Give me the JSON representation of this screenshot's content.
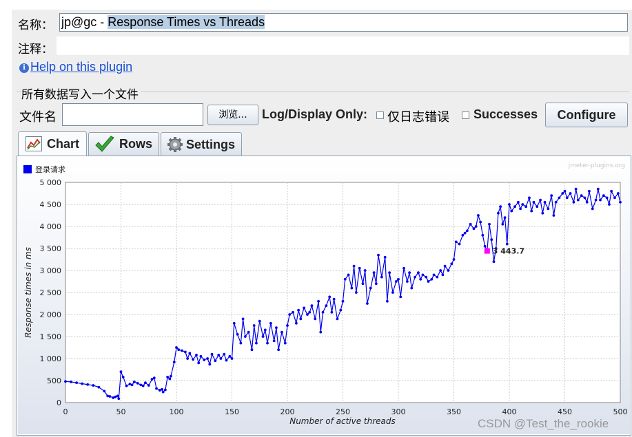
{
  "form": {
    "name_label": "名称：",
    "name_value_prefix": "jp@gc - ",
    "name_value_selected": "Response Times vs Threads",
    "comment_label": "注释：",
    "help_link": "Help on this plugin"
  },
  "file_section": {
    "group_title": "所有数据写入一个文件",
    "filename_label": "文件名",
    "filename_value": "",
    "browse_button": "浏览...",
    "log_only_label": "Log/Display Only:",
    "errors_checkbox_label": "仅日志错误",
    "successes_checkbox_label": "Successes",
    "configure_button": "Configure"
  },
  "tabs": [
    {
      "label": "Chart",
      "icon": "chart-icon",
      "active": true
    },
    {
      "label": "Rows",
      "icon": "checkmark-icon",
      "active": false
    },
    {
      "label": "Settings",
      "icon": "gear-icon",
      "active": false
    }
  ],
  "chart_credit": "jmeter-plugins.org",
  "chart_data": {
    "type": "line",
    "series": [
      {
        "name": "登录请求",
        "color": "#0000ee"
      }
    ],
    "xlabel": "Number of active threads",
    "ylabel": "Response times in ms",
    "xlim": [
      0,
      500
    ],
    "ylim": [
      0,
      5000
    ],
    "x_ticks": [
      "0",
      "50",
      "100",
      "150",
      "200",
      "250",
      "300",
      "350",
      "400",
      "450",
      "500"
    ],
    "y_ticks": [
      "0",
      "500",
      "1 000",
      "1 500",
      "2 000",
      "2 500",
      "3 000",
      "3 500",
      "4 000",
      "4 500",
      "5 000"
    ],
    "grid": true,
    "legend_position": "top-left",
    "highlight": {
      "x": 380,
      "y": 3443.7,
      "label": "3 443.7",
      "color": "#ff00ff"
    },
    "points": [
      [
        0,
        480
      ],
      [
        5,
        470
      ],
      [
        10,
        450
      ],
      [
        15,
        430
      ],
      [
        20,
        410
      ],
      [
        25,
        390
      ],
      [
        30,
        350
      ],
      [
        35,
        260
      ],
      [
        38,
        150
      ],
      [
        40,
        140
      ],
      [
        43,
        110
      ],
      [
        45,
        130
      ],
      [
        47,
        150
      ],
      [
        48,
        90
      ],
      [
        50,
        700
      ],
      [
        52,
        580
      ],
      [
        55,
        380
      ],
      [
        58,
        420
      ],
      [
        60,
        400
      ],
      [
        62,
        470
      ],
      [
        65,
        440
      ],
      [
        68,
        400
      ],
      [
        70,
        380
      ],
      [
        72,
        450
      ],
      [
        75,
        390
      ],
      [
        78,
        530
      ],
      [
        80,
        560
      ],
      [
        82,
        320
      ],
      [
        85,
        280
      ],
      [
        87,
        300
      ],
      [
        88,
        240
      ],
      [
        90,
        290
      ],
      [
        92,
        580
      ],
      [
        94,
        540
      ],
      [
        95,
        600
      ],
      [
        98,
        920
      ],
      [
        100,
        1250
      ],
      [
        102,
        1200
      ],
      [
        105,
        1180
      ],
      [
        108,
        1150
      ],
      [
        110,
        1000
      ],
      [
        112,
        1120
      ],
      [
        115,
        980
      ],
      [
        118,
        1080
      ],
      [
        120,
        900
      ],
      [
        122,
        1050
      ],
      [
        125,
        970
      ],
      [
        128,
        1000
      ],
      [
        130,
        870
      ],
      [
        132,
        1100
      ],
      [
        135,
        950
      ],
      [
        138,
        1080
      ],
      [
        140,
        1000
      ],
      [
        143,
        1100
      ],
      [
        145,
        960
      ],
      [
        148,
        1050
      ],
      [
        150,
        1000
      ],
      [
        152,
        1800
      ],
      [
        155,
        1550
      ],
      [
        158,
        1350
      ],
      [
        160,
        1900
      ],
      [
        162,
        1500
      ],
      [
        165,
        1600
      ],
      [
        168,
        1200
      ],
      [
        170,
        1750
      ],
      [
        172,
        1350
      ],
      [
        175,
        1850
      ],
      [
        178,
        1500
      ],
      [
        180,
        1650
      ],
      [
        182,
        1350
      ],
      [
        185,
        1800
      ],
      [
        188,
        1400
      ],
      [
        190,
        1700
      ],
      [
        192,
        1200
      ],
      [
        195,
        1600
      ],
      [
        198,
        1350
      ],
      [
        200,
        1750
      ],
      [
        202,
        2000
      ],
      [
        205,
        2050
      ],
      [
        208,
        1800
      ],
      [
        210,
        2100
      ],
      [
        212,
        1900
      ],
      [
        215,
        2150
      ],
      [
        218,
        2000
      ],
      [
        220,
        2050
      ],
      [
        222,
        2200
      ],
      [
        225,
        1900
      ],
      [
        228,
        2300
      ],
      [
        230,
        1600
      ],
      [
        232,
        2050
      ],
      [
        235,
        2200
      ],
      [
        238,
        2400
      ],
      [
        240,
        2050
      ],
      [
        242,
        2350
      ],
      [
        245,
        1900
      ],
      [
        248,
        2100
      ],
      [
        250,
        2300
      ],
      [
        252,
        2800
      ],
      [
        255,
        2900
      ],
      [
        258,
        2600
      ],
      [
        260,
        3100
      ],
      [
        262,
        2500
      ],
      [
        265,
        3050
      ],
      [
        268,
        2700
      ],
      [
        270,
        3000
      ],
      [
        272,
        2250
      ],
      [
        275,
        2600
      ],
      [
        278,
        2950
      ],
      [
        280,
        2700
      ],
      [
        282,
        3350
      ],
      [
        285,
        2850
      ],
      [
        288,
        3300
      ],
      [
        290,
        2300
      ],
      [
        292,
        2950
      ],
      [
        295,
        2500
      ],
      [
        298,
        2750
      ],
      [
        300,
        2800
      ],
      [
        302,
        2400
      ],
      [
        305,
        3050
      ],
      [
        308,
        2750
      ],
      [
        310,
        2950
      ],
      [
        312,
        2600
      ],
      [
        315,
        2850
      ],
      [
        318,
        2950
      ],
      [
        320,
        2800
      ],
      [
        322,
        2900
      ],
      [
        325,
        2850
      ],
      [
        327,
        2750
      ],
      [
        330,
        2800
      ],
      [
        332,
        2900
      ],
      [
        335,
        2850
      ],
      [
        338,
        3000
      ],
      [
        340,
        2900
      ],
      [
        342,
        3100
      ],
      [
        345,
        3000
      ],
      [
        348,
        3150
      ],
      [
        350,
        3250
      ],
      [
        352,
        3650
      ],
      [
        355,
        3600
      ],
      [
        358,
        3800
      ],
      [
        360,
        3850
      ],
      [
        362,
        3900
      ],
      [
        365,
        4050
      ],
      [
        368,
        3950
      ],
      [
        370,
        4000
      ],
      [
        372,
        4250
      ],
      [
        374,
        4100
      ],
      [
        376,
        3800
      ],
      [
        378,
        3550
      ],
      [
        380,
        3443.7
      ],
      [
        382,
        4050
      ],
      [
        384,
        3700
      ],
      [
        386,
        3200
      ],
      [
        388,
        3500
      ],
      [
        390,
        4300
      ],
      [
        392,
        4450
      ],
      [
        394,
        4050
      ],
      [
        396,
        4200
      ],
      [
        398,
        3600
      ],
      [
        400,
        4500
      ],
      [
        402,
        4350
      ],
      [
        405,
        4450
      ],
      [
        408,
        4550
      ],
      [
        410,
        4400
      ],
      [
        412,
        4500
      ],
      [
        415,
        4450
      ],
      [
        418,
        4650
      ],
      [
        420,
        4350
      ],
      [
        422,
        4550
      ],
      [
        425,
        4450
      ],
      [
        428,
        4600
      ],
      [
        430,
        4300
      ],
      [
        432,
        4550
      ],
      [
        435,
        4400
      ],
      [
        438,
        4700
      ],
      [
        440,
        4250
      ],
      [
        442,
        4550
      ],
      [
        445,
        4650
      ],
      [
        448,
        4750
      ],
      [
        450,
        4800
      ],
      [
        452,
        4650
      ],
      [
        455,
        4750
      ],
      [
        458,
        4550
      ],
      [
        460,
        4850
      ],
      [
        462,
        4600
      ],
      [
        465,
        4700
      ],
      [
        468,
        4650
      ],
      [
        470,
        4550
      ],
      [
        472,
        4800
      ],
      [
        475,
        4400
      ],
      [
        478,
        4600
      ],
      [
        480,
        4850
      ],
      [
        482,
        4600
      ],
      [
        485,
        4700
      ],
      [
        488,
        4650
      ],
      [
        490,
        4500
      ],
      [
        492,
        4800
      ],
      [
        495,
        4650
      ],
      [
        498,
        4750
      ],
      [
        500,
        4550
      ]
    ]
  },
  "watermark": "CSDN @Test_the_rookie"
}
